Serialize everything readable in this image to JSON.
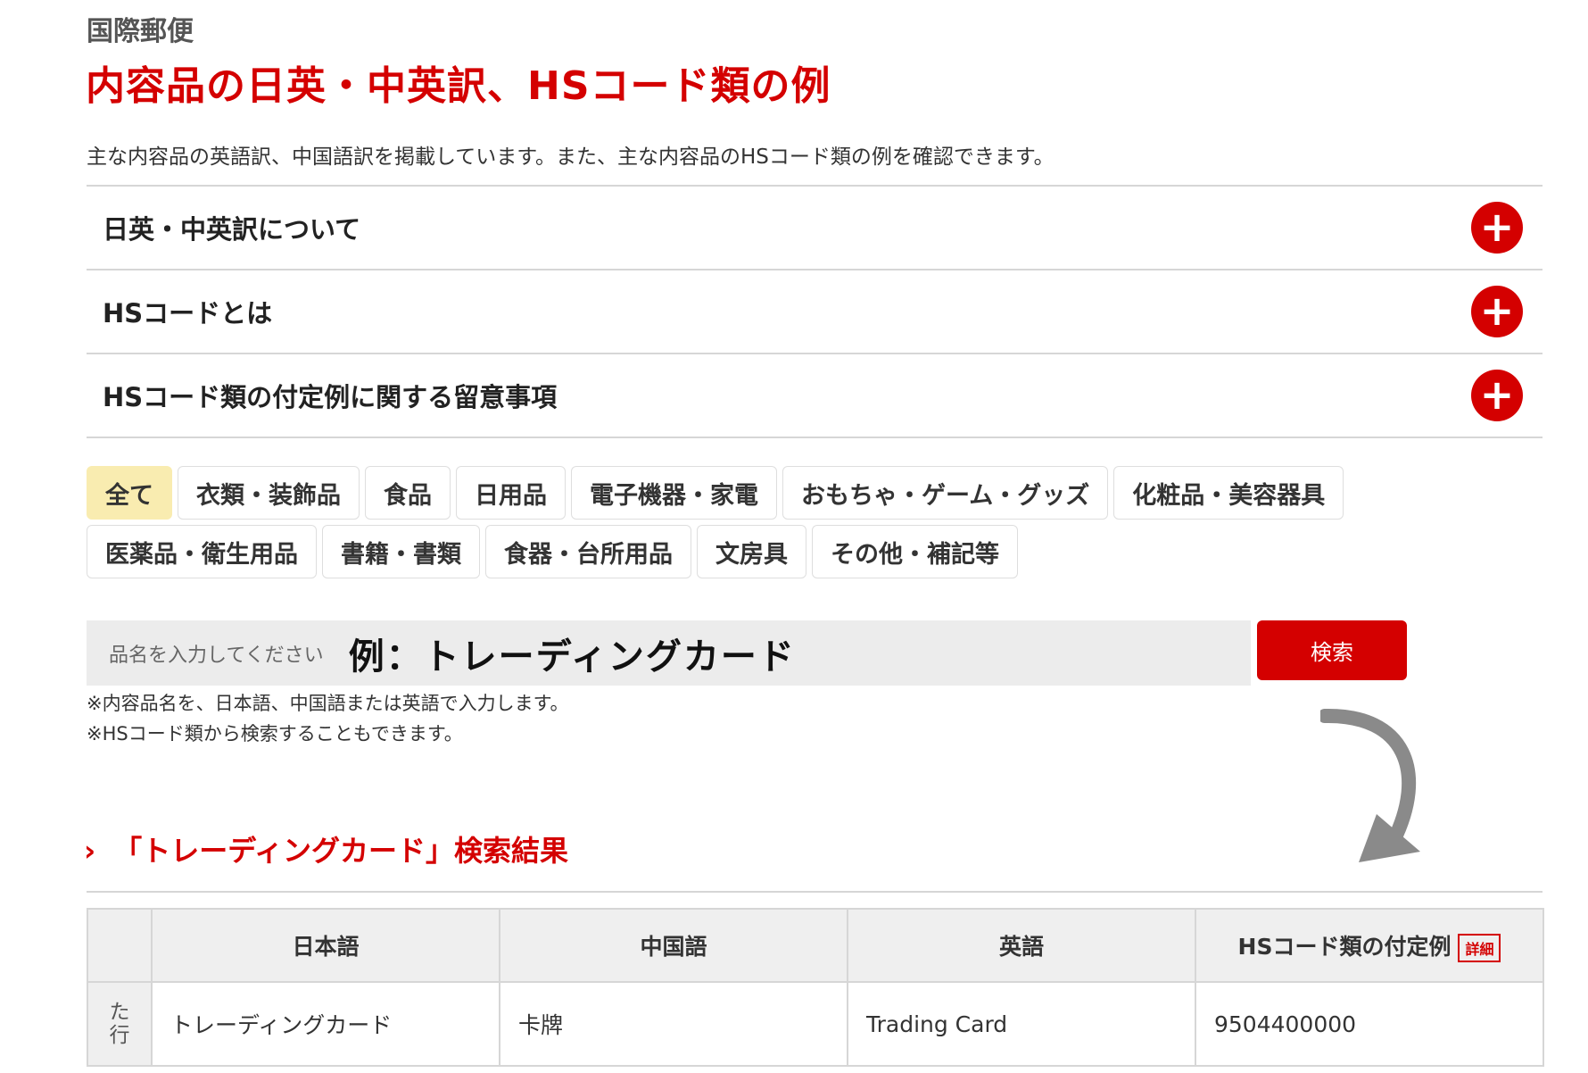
{
  "header": {
    "eyebrow": "国際郵便",
    "title": "内容品の日英・中英訳、HSコード類の例",
    "lead": "主な内容品の英語訳、中国語訳を掲載しています。また、主な内容品のHSコード類の例を確認できます。"
  },
  "accordion": [
    {
      "label": "日英・中英訳について",
      "icon": "plus-circle-icon"
    },
    {
      "label": "HSコードとは",
      "icon": "plus-circle-icon"
    },
    {
      "label": "HSコード類の付定例に関する留意事項",
      "icon": "plus-circle-icon"
    }
  ],
  "categories": {
    "row1": [
      "全て",
      "衣類・装飾品",
      "食品",
      "日用品",
      "電子機器・家電",
      "おもちゃ・ゲーム・グッズ",
      "化粧品・美容器具"
    ],
    "row2": [
      "医薬品・衛生用品",
      "書籍・書類",
      "食器・台所用品",
      "文房具",
      "その他・補記等"
    ],
    "active": "全て"
  },
  "search": {
    "placeholder": "品名を入力してください",
    "example": "例：トレーディングカード",
    "button": "検索",
    "notes": [
      "※内容品名を、日本語、中国語または英語で入力します。",
      "※HSコード類から検索することもできます。"
    ]
  },
  "result": {
    "heading": "「トレーディングカード」検索結果",
    "columns": [
      "日本語",
      "中国語",
      "英語",
      "HSコード類の付定例"
    ],
    "detail_label": "詳細",
    "rows": [
      {
        "group": "た行",
        "ja": "トレーディングカード",
        "zh": "卡牌",
        "en": "Trading Card",
        "hs": "9504400000"
      }
    ]
  },
  "colors": {
    "accent": "#d40000",
    "active_tab": "#f9ecb0",
    "border": "#d6d6d6",
    "table_header": "#efefef"
  }
}
